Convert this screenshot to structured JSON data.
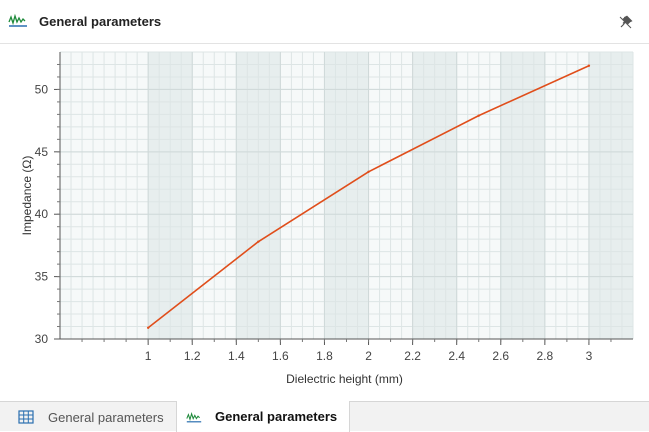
{
  "panel": {
    "title": "General parameters",
    "icon": "waveform-chart-icon",
    "pin_icon": "unpin-icon"
  },
  "tabs": [
    {
      "label": "General parameters",
      "icon": "table-grid-icon",
      "active": false
    },
    {
      "label": "General parameters",
      "icon": "waveform-chart-icon",
      "active": true
    }
  ],
  "colors": {
    "series_line": "#e04e1b",
    "icon_green": "#1e8a3a",
    "icon_blue": "#2a6fb0"
  },
  "chart_data": {
    "type": "line",
    "xlabel": "Dielectric height (mm)",
    "ylabel": "Impedance (Ω)",
    "xlim": [
      0.6,
      3.2
    ],
    "ylim": [
      30,
      53
    ],
    "x_ticks": [
      1,
      1.2,
      1.4,
      1.6,
      1.8,
      2,
      2.2,
      2.4,
      2.6,
      2.8,
      3
    ],
    "x_tick_labels": [
      "1",
      "1.2",
      "1.4",
      "1.6",
      "1.8",
      "2",
      "2.2",
      "2.4",
      "2.6",
      "2.8",
      "3"
    ],
    "y_ticks": [
      30,
      35,
      40,
      45,
      50
    ],
    "y_tick_labels": [
      "30",
      "35",
      "40",
      "45",
      "50"
    ],
    "grid": true,
    "series": [
      {
        "x": [
          1,
          1.5,
          2,
          2.5,
          3
        ],
        "y": [
          30.9,
          37.8,
          43.4,
          47.9,
          51.9
        ]
      }
    ]
  }
}
